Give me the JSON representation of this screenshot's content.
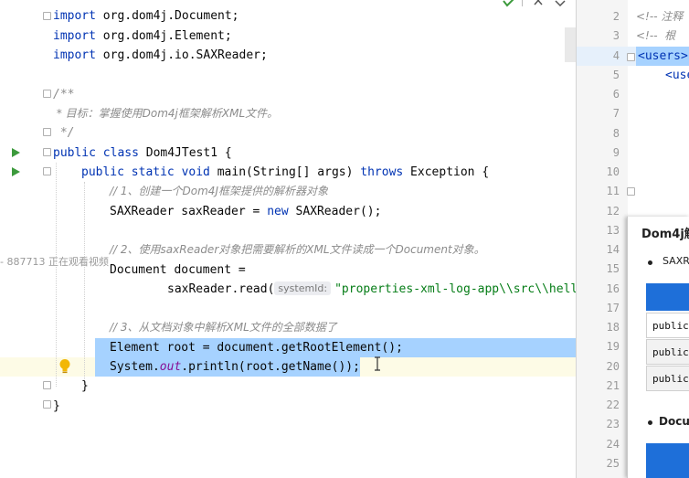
{
  "editor": {
    "lines": {
      "l1_kw": "import",
      "l1_rest": " org.dom4j.Document;",
      "l2_kw": "import",
      "l2_rest": " org.dom4j.Element;",
      "l3_kw": "import",
      "l3_rest": " org.dom4j.io.SAXReader;",
      "l5": "/**",
      "l6": " * 目标：掌握使用Dom4j框架解析XML文件。",
      "l7": " */",
      "l8_kw": "public class",
      "l8_rest": " Dom4JTest1 {",
      "l9_kw1": "public static void",
      "l9_mid": " main(String[] args) ",
      "l9_kw2": "throws",
      "l9_rest": " Exception {",
      "l10": "// 1、创建一个Dom4J框架提供的解析器对象",
      "l11_a": "SAXReader saxReader = ",
      "l11_kw": "new",
      "l11_b": " SAXReader();",
      "l13": "// 2、使用saxReader对象把需要解析的XML文件读成一个Document对象。",
      "l14": "Document document =",
      "l15_a": "saxReader.read(",
      "l15_hint": "systemId:",
      "l15_str": "\"properties-xml-log-app\\\\src\\\\hell",
      "l17": "// 3、从文档对象中解析XML文件的全部数据了",
      "l18": "Element root = document.getRootElement();",
      "l19_a": "System.",
      "l19_static": "out",
      "l19_b": ".println(root.getName());",
      "l20": "}",
      "l21": "}"
    },
    "overlay": "- 887713 正在观看视频"
  },
  "right_editor": {
    "line_numbers": [
      "2",
      "3",
      "4",
      "5",
      "6",
      "7",
      "8",
      "9",
      "10",
      "11",
      "12",
      "13",
      "14",
      "15",
      "16",
      "17",
      "18",
      "19",
      "20",
      "21",
      "22",
      "23",
      "24",
      "25"
    ],
    "lines": {
      "r1": "<!-- 注释",
      "r2": "<!--  根",
      "r3": "<users>",
      "r4": "<use"
    }
  },
  "doc_panel": {
    "title": "Dom4j解",
    "bullet1": "SAXR",
    "table1_rows": [
      "public",
      "public",
      "public"
    ],
    "bullet2": "Docu"
  },
  "colors": {
    "keyword": "#0033b3",
    "comment": "#8c8c8c",
    "string": "#067d17",
    "selection": "#a6d2ff",
    "table_header": "#1e6fd9"
  }
}
